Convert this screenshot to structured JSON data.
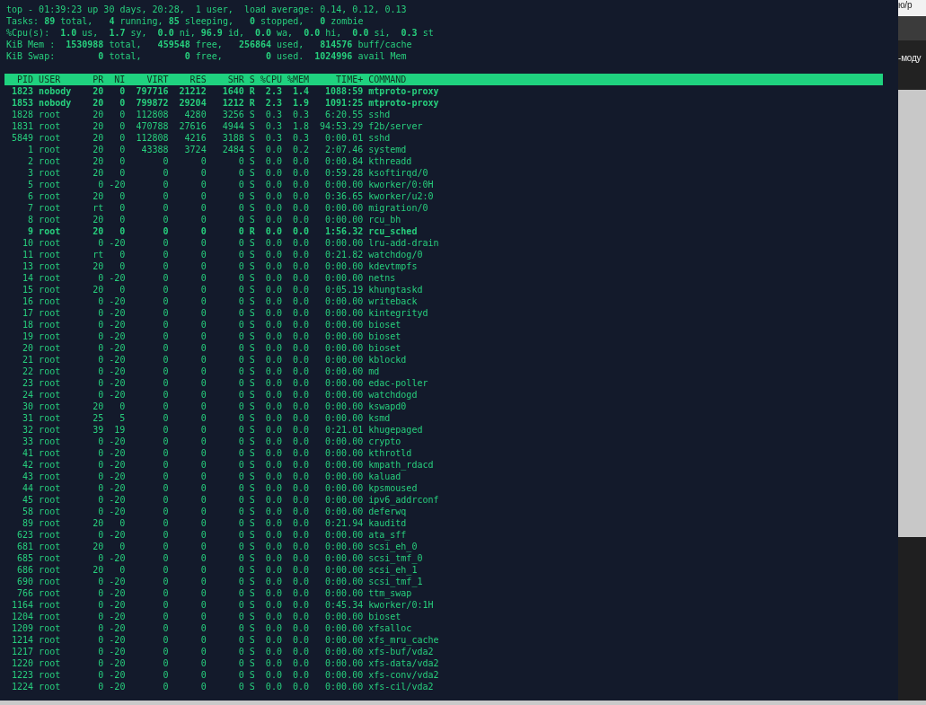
{
  "summary": [
    "top - 01:39:23 up 30 days, 20:28,  1 user,  load average: 0.14, 0.12, 0.13",
    "Tasks: **89** total,   **4** running, **85** sleeping,   **0** stopped,   **0** zombie",
    "%Cpu(s):  **1.0** us,  **1.7** sy,  **0.0** ni, **96.9** id,  **0.0** wa,  **0.0** hi,  **0.0** si,  **0.3** st",
    "KiB Mem :  **1530988** total,   **459548** free,   **256864** used,   **814576** buff/cache",
    "KiB Swap:        **0** total,        **0** free,        **0** used.  **1024996** avail Mem"
  ],
  "table": {
    "columns": [
      "PID",
      "USER",
      "PR",
      "NI",
      "VIRT",
      "RES",
      "SHR",
      "S",
      "%CPU",
      "%MEM",
      "TIME+",
      "COMMAND"
    ],
    "rows": [
      {
        "highlighted": true,
        "cells": [
          "1823",
          "nobody",
          "20",
          "0",
          "797716",
          "21212",
          "1640",
          "R",
          "2.3",
          "1.4",
          "1088:59",
          "mtproto-proxy"
        ]
      },
      {
        "highlighted": true,
        "cells": [
          "1853",
          "nobody",
          "20",
          "0",
          "799872",
          "29204",
          "1212",
          "R",
          "2.3",
          "1.9",
          "1091:25",
          "mtproto-proxy"
        ]
      },
      {
        "highlighted": false,
        "cells": [
          "1828",
          "root",
          "20",
          "0",
          "112808",
          "4280",
          "3256",
          "S",
          "0.3",
          "0.3",
          "6:20.55",
          "sshd"
        ]
      },
      {
        "highlighted": false,
        "cells": [
          "1831",
          "root",
          "20",
          "0",
          "470788",
          "27616",
          "4944",
          "S",
          "0.3",
          "1.8",
          "94:53.29",
          "f2b/server"
        ]
      },
      {
        "highlighted": false,
        "cells": [
          "5849",
          "root",
          "20",
          "0",
          "112808",
          "4216",
          "3188",
          "S",
          "0.3",
          "0.3",
          "0:00.01",
          "sshd"
        ]
      },
      {
        "highlighted": false,
        "cells": [
          "1",
          "root",
          "20",
          "0",
          "43388",
          "3724",
          "2484",
          "S",
          "0.0",
          "0.2",
          "2:07.46",
          "systemd"
        ]
      },
      {
        "highlighted": false,
        "cells": [
          "2",
          "root",
          "20",
          "0",
          "0",
          "0",
          "0",
          "S",
          "0.0",
          "0.0",
          "0:00.84",
          "kthreadd"
        ]
      },
      {
        "highlighted": false,
        "cells": [
          "3",
          "root",
          "20",
          "0",
          "0",
          "0",
          "0",
          "S",
          "0.0",
          "0.0",
          "0:59.28",
          "ksoftirqd/0"
        ]
      },
      {
        "highlighted": false,
        "cells": [
          "5",
          "root",
          "0",
          "-20",
          "0",
          "0",
          "0",
          "S",
          "0.0",
          "0.0",
          "0:00.00",
          "kworker/0:0H"
        ]
      },
      {
        "highlighted": false,
        "cells": [
          "6",
          "root",
          "20",
          "0",
          "0",
          "0",
          "0",
          "S",
          "0.0",
          "0.0",
          "0:36.65",
          "kworker/u2:0"
        ]
      },
      {
        "highlighted": false,
        "cells": [
          "7",
          "root",
          "rt",
          "0",
          "0",
          "0",
          "0",
          "S",
          "0.0",
          "0.0",
          "0:00.00",
          "migration/0"
        ]
      },
      {
        "highlighted": false,
        "cells": [
          "8",
          "root",
          "20",
          "0",
          "0",
          "0",
          "0",
          "S",
          "0.0",
          "0.0",
          "0:00.00",
          "rcu_bh"
        ]
      },
      {
        "highlighted": true,
        "cells": [
          "9",
          "root",
          "20",
          "0",
          "0",
          "0",
          "0",
          "R",
          "0.0",
          "0.0",
          "1:56.32",
          "rcu_sched"
        ]
      },
      {
        "highlighted": false,
        "cells": [
          "10",
          "root",
          "0",
          "-20",
          "0",
          "0",
          "0",
          "S",
          "0.0",
          "0.0",
          "0:00.00",
          "lru-add-drain"
        ]
      },
      {
        "highlighted": false,
        "cells": [
          "11",
          "root",
          "rt",
          "0",
          "0",
          "0",
          "0",
          "S",
          "0.0",
          "0.0",
          "0:21.82",
          "watchdog/0"
        ]
      },
      {
        "highlighted": false,
        "cells": [
          "13",
          "root",
          "20",
          "0",
          "0",
          "0",
          "0",
          "S",
          "0.0",
          "0.0",
          "0:00.00",
          "kdevtmpfs"
        ]
      },
      {
        "highlighted": false,
        "cells": [
          "14",
          "root",
          "0",
          "-20",
          "0",
          "0",
          "0",
          "S",
          "0.0",
          "0.0",
          "0:00.00",
          "netns"
        ]
      },
      {
        "highlighted": false,
        "cells": [
          "15",
          "root",
          "20",
          "0",
          "0",
          "0",
          "0",
          "S",
          "0.0",
          "0.0",
          "0:05.19",
          "khungtaskd"
        ]
      },
      {
        "highlighted": false,
        "cells": [
          "16",
          "root",
          "0",
          "-20",
          "0",
          "0",
          "0",
          "S",
          "0.0",
          "0.0",
          "0:00.00",
          "writeback"
        ]
      },
      {
        "highlighted": false,
        "cells": [
          "17",
          "root",
          "0",
          "-20",
          "0",
          "0",
          "0",
          "S",
          "0.0",
          "0.0",
          "0:00.00",
          "kintegrityd"
        ]
      },
      {
        "highlighted": false,
        "cells": [
          "18",
          "root",
          "0",
          "-20",
          "0",
          "0",
          "0",
          "S",
          "0.0",
          "0.0",
          "0:00.00",
          "bioset"
        ]
      },
      {
        "highlighted": false,
        "cells": [
          "19",
          "root",
          "0",
          "-20",
          "0",
          "0",
          "0",
          "S",
          "0.0",
          "0.0",
          "0:00.00",
          "bioset"
        ]
      },
      {
        "highlighted": false,
        "cells": [
          "20",
          "root",
          "0",
          "-20",
          "0",
          "0",
          "0",
          "S",
          "0.0",
          "0.0",
          "0:00.00",
          "bioset"
        ]
      },
      {
        "highlighted": false,
        "cells": [
          "21",
          "root",
          "0",
          "-20",
          "0",
          "0",
          "0",
          "S",
          "0.0",
          "0.0",
          "0:00.00",
          "kblockd"
        ]
      },
      {
        "highlighted": false,
        "cells": [
          "22",
          "root",
          "0",
          "-20",
          "0",
          "0",
          "0",
          "S",
          "0.0",
          "0.0",
          "0:00.00",
          "md"
        ]
      },
      {
        "highlighted": false,
        "cells": [
          "23",
          "root",
          "0",
          "-20",
          "0",
          "0",
          "0",
          "S",
          "0.0",
          "0.0",
          "0:00.00",
          "edac-poller"
        ]
      },
      {
        "highlighted": false,
        "cells": [
          "24",
          "root",
          "0",
          "-20",
          "0",
          "0",
          "0",
          "S",
          "0.0",
          "0.0",
          "0:00.00",
          "watchdogd"
        ]
      },
      {
        "highlighted": false,
        "cells": [
          "30",
          "root",
          "20",
          "0",
          "0",
          "0",
          "0",
          "S",
          "0.0",
          "0.0",
          "0:00.00",
          "kswapd0"
        ]
      },
      {
        "highlighted": false,
        "cells": [
          "31",
          "root",
          "25",
          "5",
          "0",
          "0",
          "0",
          "S",
          "0.0",
          "0.0",
          "0:00.00",
          "ksmd"
        ]
      },
      {
        "highlighted": false,
        "cells": [
          "32",
          "root",
          "39",
          "19",
          "0",
          "0",
          "0",
          "S",
          "0.0",
          "0.0",
          "0:21.01",
          "khugepaged"
        ]
      },
      {
        "highlighted": false,
        "cells": [
          "33",
          "root",
          "0",
          "-20",
          "0",
          "0",
          "0",
          "S",
          "0.0",
          "0.0",
          "0:00.00",
          "crypto"
        ]
      },
      {
        "highlighted": false,
        "cells": [
          "41",
          "root",
          "0",
          "-20",
          "0",
          "0",
          "0",
          "S",
          "0.0",
          "0.0",
          "0:00.00",
          "kthrotld"
        ]
      },
      {
        "highlighted": false,
        "cells": [
          "42",
          "root",
          "0",
          "-20",
          "0",
          "0",
          "0",
          "S",
          "0.0",
          "0.0",
          "0:00.00",
          "kmpath_rdacd"
        ]
      },
      {
        "highlighted": false,
        "cells": [
          "43",
          "root",
          "0",
          "-20",
          "0",
          "0",
          "0",
          "S",
          "0.0",
          "0.0",
          "0:00.00",
          "kaluad"
        ]
      },
      {
        "highlighted": false,
        "cells": [
          "44",
          "root",
          "0",
          "-20",
          "0",
          "0",
          "0",
          "S",
          "0.0",
          "0.0",
          "0:00.00",
          "kpsmoused"
        ]
      },
      {
        "highlighted": false,
        "cells": [
          "45",
          "root",
          "0",
          "-20",
          "0",
          "0",
          "0",
          "S",
          "0.0",
          "0.0",
          "0:00.00",
          "ipv6_addrconf"
        ]
      },
      {
        "highlighted": false,
        "cells": [
          "58",
          "root",
          "0",
          "-20",
          "0",
          "0",
          "0",
          "S",
          "0.0",
          "0.0",
          "0:00.00",
          "deferwq"
        ]
      },
      {
        "highlighted": false,
        "cells": [
          "89",
          "root",
          "20",
          "0",
          "0",
          "0",
          "0",
          "S",
          "0.0",
          "0.0",
          "0:21.94",
          "kauditd"
        ]
      },
      {
        "highlighted": false,
        "cells": [
          "623",
          "root",
          "0",
          "-20",
          "0",
          "0",
          "0",
          "S",
          "0.0",
          "0.0",
          "0:00.00",
          "ata_sff"
        ]
      },
      {
        "highlighted": false,
        "cells": [
          "681",
          "root",
          "20",
          "0",
          "0",
          "0",
          "0",
          "S",
          "0.0",
          "0.0",
          "0:00.00",
          "scsi_eh_0"
        ]
      },
      {
        "highlighted": false,
        "cells": [
          "685",
          "root",
          "0",
          "-20",
          "0",
          "0",
          "0",
          "S",
          "0.0",
          "0.0",
          "0:00.00",
          "scsi_tmf_0"
        ]
      },
      {
        "highlighted": false,
        "cells": [
          "686",
          "root",
          "20",
          "0",
          "0",
          "0",
          "0",
          "S",
          "0.0",
          "0.0",
          "0:00.00",
          "scsi_eh_1"
        ]
      },
      {
        "highlighted": false,
        "cells": [
          "690",
          "root",
          "0",
          "-20",
          "0",
          "0",
          "0",
          "S",
          "0.0",
          "0.0",
          "0:00.00",
          "scsi_tmf_1"
        ]
      },
      {
        "highlighted": false,
        "cells": [
          "766",
          "root",
          "0",
          "-20",
          "0",
          "0",
          "0",
          "S",
          "0.0",
          "0.0",
          "0:00.00",
          "ttm_swap"
        ]
      },
      {
        "highlighted": false,
        "cells": [
          "1164",
          "root",
          "0",
          "-20",
          "0",
          "0",
          "0",
          "S",
          "0.0",
          "0.0",
          "0:45.34",
          "kworker/0:1H"
        ]
      },
      {
        "highlighted": false,
        "cells": [
          "1204",
          "root",
          "0",
          "-20",
          "0",
          "0",
          "0",
          "S",
          "0.0",
          "0.0",
          "0:00.00",
          "bioset"
        ]
      },
      {
        "highlighted": false,
        "cells": [
          "1209",
          "root",
          "0",
          "-20",
          "0",
          "0",
          "0",
          "S",
          "0.0",
          "0.0",
          "0:00.00",
          "xfsalloc"
        ]
      },
      {
        "highlighted": false,
        "cells": [
          "1214",
          "root",
          "0",
          "-20",
          "0",
          "0",
          "0",
          "S",
          "0.0",
          "0.0",
          "0:00.00",
          "xfs_mru_cache"
        ]
      },
      {
        "highlighted": false,
        "cells": [
          "1217",
          "root",
          "0",
          "-20",
          "0",
          "0",
          "0",
          "S",
          "0.0",
          "0.0",
          "0:00.00",
          "xfs-buf/vda2"
        ]
      },
      {
        "highlighted": false,
        "cells": [
          "1220",
          "root",
          "0",
          "-20",
          "0",
          "0",
          "0",
          "S",
          "0.0",
          "0.0",
          "0:00.00",
          "xfs-data/vda2"
        ]
      },
      {
        "highlighted": false,
        "cells": [
          "1223",
          "root",
          "0",
          "-20",
          "0",
          "0",
          "0",
          "S",
          "0.0",
          "0.0",
          "0:00.00",
          "xfs-conv/vda2"
        ]
      },
      {
        "highlighted": false,
        "cells": [
          "1224",
          "root",
          "0",
          "-20",
          "0",
          "0",
          "0",
          "S",
          "0.0",
          "0.0",
          "0:00.00",
          "xfs-cil/vda2"
        ]
      }
    ]
  },
  "side_page": {
    "texts": [
      "ю/р",
      "-моду"
    ]
  }
}
